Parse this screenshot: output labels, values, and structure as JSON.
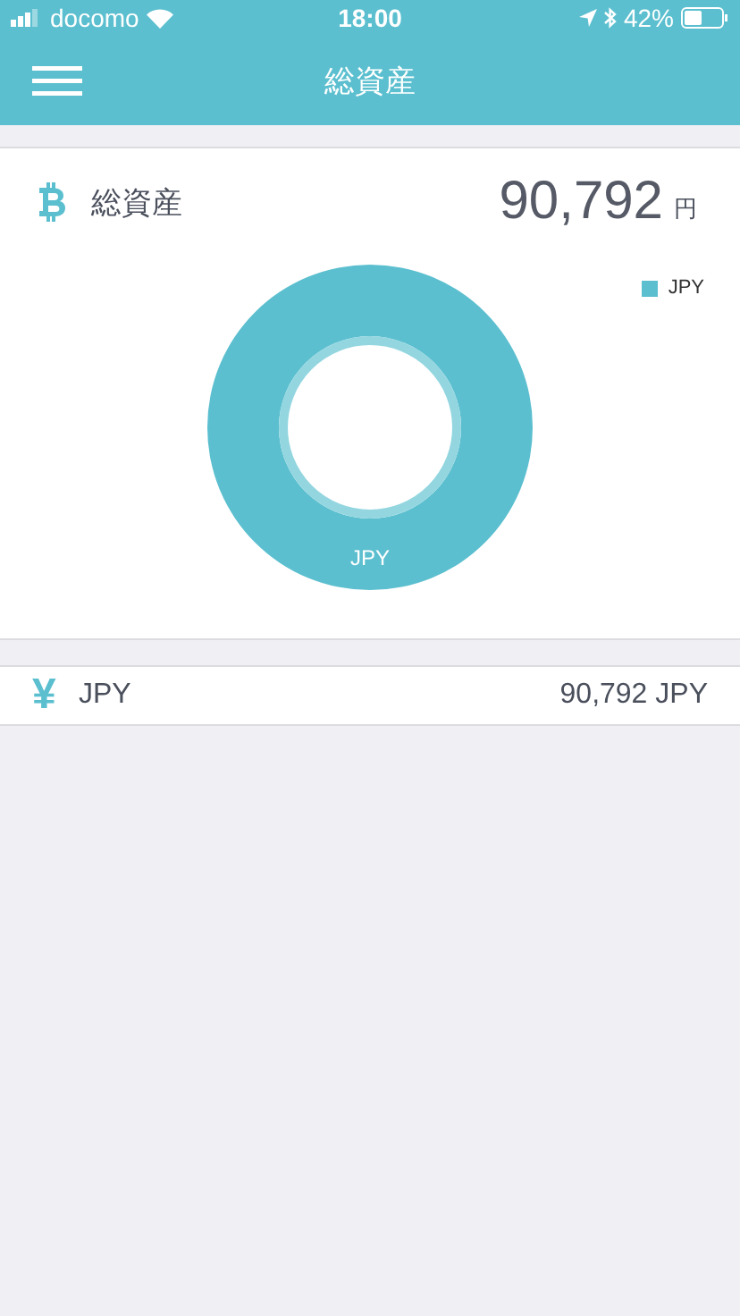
{
  "status_bar": {
    "carrier": "docomo",
    "time": "18:00",
    "battery": "42%"
  },
  "nav_bar": {
    "title": "総資産"
  },
  "total": {
    "label": "総資産",
    "amount": "90,792",
    "unit": "円",
    "chart": {
      "slice_label": "JPY",
      "legend": [
        "JPY"
      ]
    }
  },
  "assets": [
    {
      "symbol": "¥",
      "name": "JPY",
      "amount": "90,792 JPY"
    }
  ]
}
